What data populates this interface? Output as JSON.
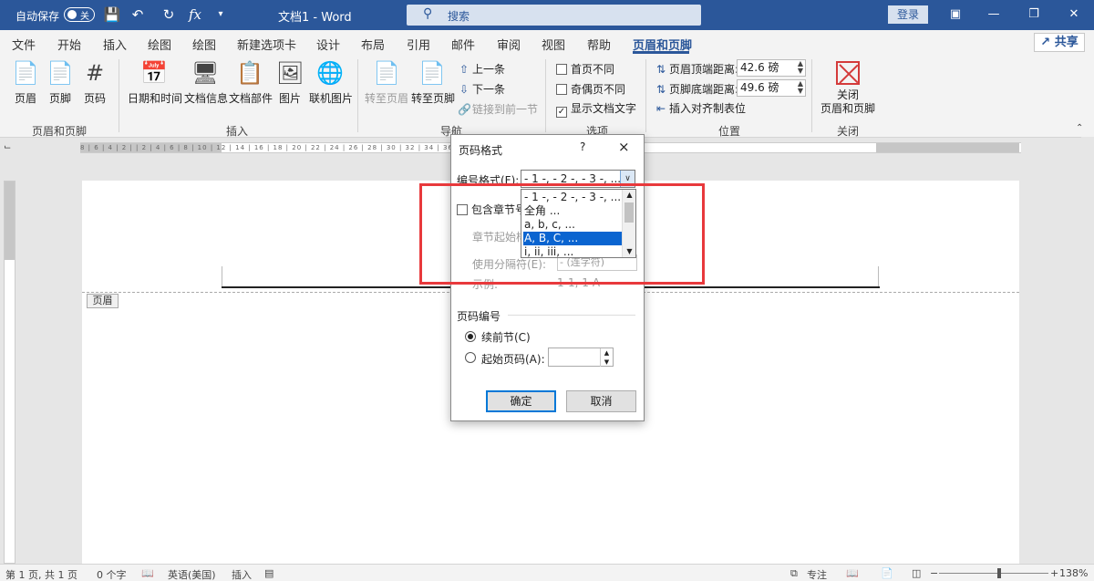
{
  "titlebar": {
    "autosave_label": "自动保存",
    "autosave_state": "关",
    "doc_title": "文档1  -  Word",
    "search_placeholder": "搜索",
    "login": "登录"
  },
  "menu": {
    "tabs": [
      "文件",
      "开始",
      "插入",
      "绘图",
      "绘图",
      "新建选项卡",
      "设计",
      "布局",
      "引用",
      "邮件",
      "审阅",
      "视图",
      "帮助",
      "页眉和页脚"
    ],
    "active_tab": "页眉和页脚",
    "share": "共享"
  },
  "ribbon": {
    "group_header_footer": {
      "label": "页眉和页脚",
      "buttons": [
        "页眉",
        "页脚",
        "页码"
      ]
    },
    "group_insert": {
      "label": "插入",
      "buttons": [
        "日期和时间",
        "文档信息",
        "文档部件",
        "图片",
        "联机图片"
      ]
    },
    "group_nav": {
      "label": "导航",
      "goto_header": "转至页眉",
      "goto_footer": "转至页脚",
      "prev": "上一条",
      "next": "下一条",
      "link_prev": "链接到前一节"
    },
    "group_options": {
      "label": "选项",
      "diff_first": "首页不同",
      "diff_odd_even": "奇偶页不同",
      "show_text": "显示文档文字"
    },
    "group_position": {
      "label": "位置",
      "header_top_label": "页眉顶端距离:",
      "header_top_value": "42.6 磅",
      "footer_bottom_label": "页脚底端距离:",
      "footer_bottom_value": "49.6 磅",
      "insert_align_tab": "插入对齐制表位"
    },
    "group_close": {
      "label": "关闭",
      "close_btn": "关闭\n页眉和页脚"
    }
  },
  "ruler_h_text": "8 | 6 | 4 | 2 | | 2 | 4 | 6 | 8 | 10 | 12 | 14 | 16 | 18 | 20 | 22 | 24 | 26 | 28 | 30 | 32 | 34 | 36 | 38 | 40 | 42 | 44 | 46 | 48 |",
  "document": {
    "header_tag": "页眉"
  },
  "dialog": {
    "title": "页码格式",
    "help": "?",
    "close": "×",
    "number_format_label": "编号格式(F):",
    "number_format_value": "- 1 -, - 2 -, - 3 -, ...",
    "dropdown_items": [
      "- 1 -, - 2 -, - 3 -, ...",
      "全角 ...",
      "a, b, c, ...",
      "A, B, C, ...",
      "i, ii, iii, ..."
    ],
    "dropdown_selected": "A, B, C, ...",
    "include_chapter": "包含章节号",
    "chapter_start": "章节起始样",
    "separator_label": "使用分隔符(E):",
    "separator_value": "- (连字符)",
    "example_label": "示例:",
    "example_value": "1-1, 1-A",
    "numbering_section": "页码编号",
    "continue": "续前节(C)",
    "start_at": "起始页码(A):",
    "ok": "确定",
    "cancel": "取消"
  },
  "statusbar": {
    "page": "第 1 页, 共 1 页",
    "words": "0 个字",
    "language": "英语(美国)",
    "mode": "插入",
    "focus": "专注",
    "zoom": "138%"
  },
  "colors": {
    "titlebar": "#2b579a",
    "highlight": "#e8393c",
    "selection": "#0a64d0"
  }
}
